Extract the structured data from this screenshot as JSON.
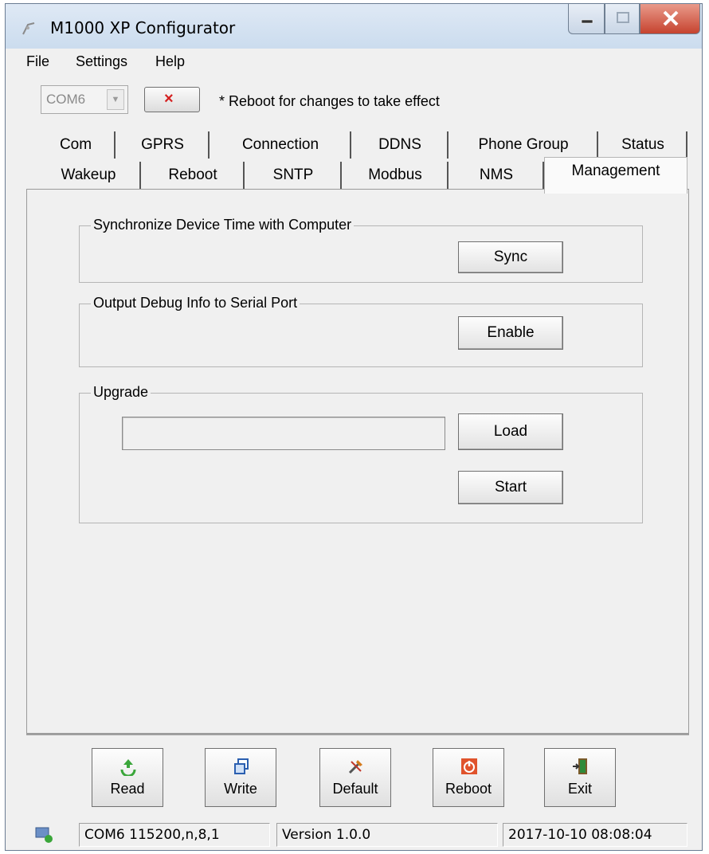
{
  "window": {
    "title": "M1000 XP Configurator"
  },
  "menu": [
    "File",
    "Settings",
    "Help"
  ],
  "toolbar": {
    "port": "COM6",
    "close_icon": "×",
    "note": "* Reboot for changes to take effect"
  },
  "tabs": {
    "row1": [
      "Com",
      "GPRS",
      "Connection",
      "DDNS",
      "Phone Group",
      "Status"
    ],
    "row2": [
      "Wakeup",
      "Reboot",
      "SNTP",
      "Modbus",
      "NMS"
    ],
    "active": "Management"
  },
  "management": {
    "sync_group": "Synchronize Device Time with Computer",
    "sync_button": "Sync",
    "debug_group": "Output Debug Info to Serial Port",
    "enable_button": "Enable",
    "upgrade_group": "Upgrade",
    "upgrade_path": "",
    "load_button": "Load",
    "start_button": "Start"
  },
  "bottom_buttons": [
    {
      "label": "Read",
      "icon": "recycle-icon"
    },
    {
      "label": "Write",
      "icon": "copy-icon"
    },
    {
      "label": "Default",
      "icon": "tools-icon"
    },
    {
      "label": "Reboot",
      "icon": "power-icon"
    },
    {
      "label": "Exit",
      "icon": "door-exit-icon"
    }
  ],
  "statusbar": {
    "connection": "COM6 115200,n,8,1",
    "version": "Version 1.0.0",
    "datetime": "2017-10-10 08:08:04"
  },
  "colors": {
    "close_red": "#c6432f",
    "x_red": "#d42020",
    "titlebar": "#cbdcee"
  }
}
